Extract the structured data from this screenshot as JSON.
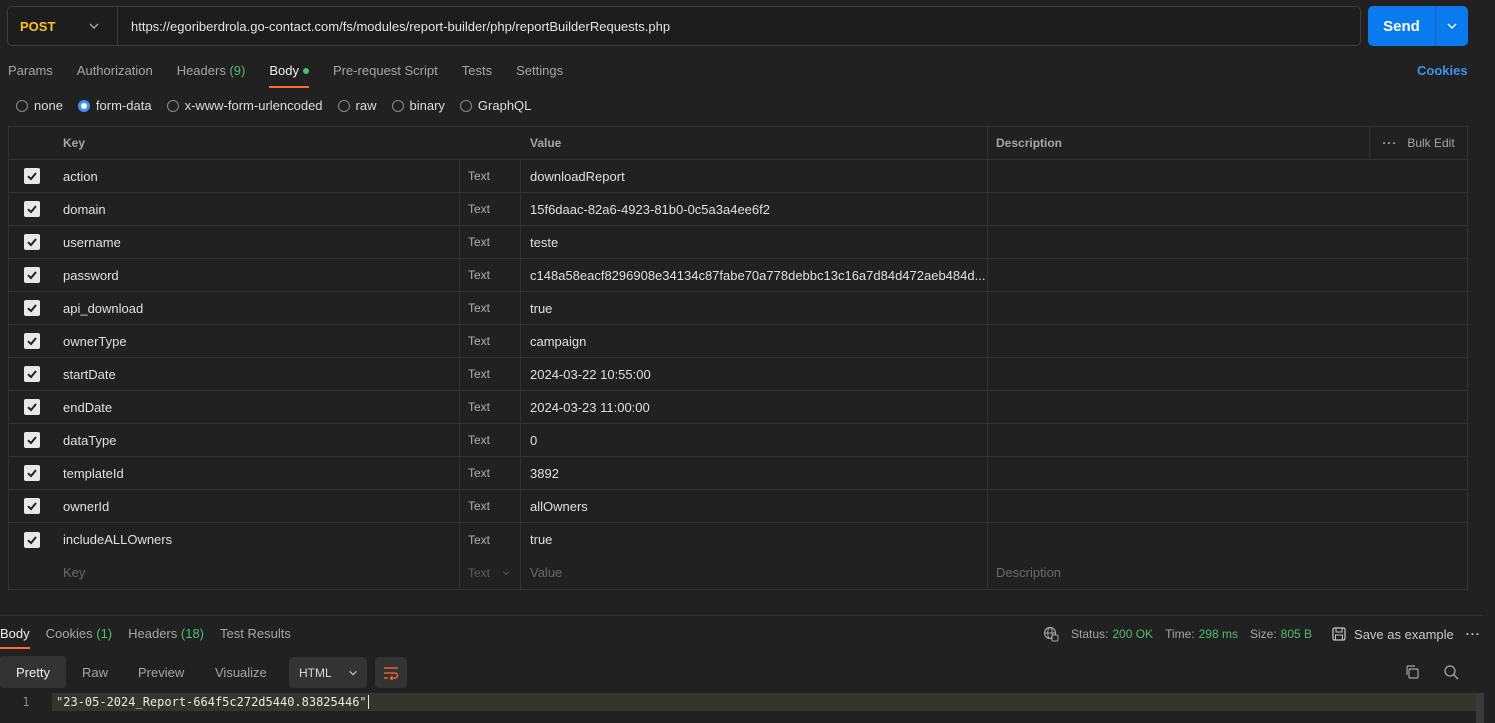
{
  "request": {
    "method": "POST",
    "url": "https://egoriberdrola.go-contact.com/fs/modules/report-builder/php/reportBuilderRequests.php",
    "send_label": "Send"
  },
  "request_tabs": [
    {
      "label": "Params"
    },
    {
      "label": "Authorization"
    },
    {
      "label": "Headers",
      "count": "(9)"
    },
    {
      "label": "Body",
      "active": true
    },
    {
      "label": "Pre-request Script"
    },
    {
      "label": "Tests"
    },
    {
      "label": "Settings"
    }
  ],
  "cookies_label": "Cookies",
  "body_types": [
    "none",
    "form-data",
    "x-www-form-urlencoded",
    "raw",
    "binary",
    "GraphQL"
  ],
  "body_type_selected": "form-data",
  "table": {
    "headers": {
      "key": "Key",
      "value": "Value",
      "description": "Description",
      "bulk_edit": "Bulk Edit"
    },
    "rows": [
      {
        "key": "action",
        "type": "Text",
        "value": "downloadReport"
      },
      {
        "key": "domain",
        "type": "Text",
        "value": "15f6daac-82a6-4923-81b0-0c5a3a4ee6f2"
      },
      {
        "key": "username",
        "type": "Text",
        "value": "teste"
      },
      {
        "key": "password",
        "type": "Text",
        "value": "c148a58eacf8296908e34134c87fabe70a778debbc13c16a7d84d472aeb484d..."
      },
      {
        "key": "api_download",
        "type": "Text",
        "value": "true"
      },
      {
        "key": "ownerType",
        "type": "Text",
        "value": "campaign"
      },
      {
        "key": "startDate",
        "type": "Text",
        "value": "2024-03-22 10:55:00"
      },
      {
        "key": "endDate",
        "type": "Text",
        "value": "2024-03-23 11:00:00"
      },
      {
        "key": "dataType",
        "type": "Text",
        "value": "0"
      },
      {
        "key": "templateId",
        "type": "Text",
        "value": "3892"
      },
      {
        "key": "ownerId",
        "type": "Text",
        "value": "allOwners"
      },
      {
        "key": "includeALLOwners",
        "type": "Text",
        "value": "true"
      }
    ],
    "placeholder": {
      "key": "Key",
      "type": "Text",
      "value": "Value",
      "description": "Description"
    }
  },
  "response": {
    "tabs": [
      {
        "label": "Body",
        "active": true
      },
      {
        "label": "Cookies",
        "count": "(1)"
      },
      {
        "label": "Headers",
        "count": "(18)"
      },
      {
        "label": "Test Results"
      }
    ],
    "status_label": "Status:",
    "status_value": "200 OK",
    "time_label": "Time:",
    "time_value": "298 ms",
    "size_label": "Size:",
    "size_value": "805 B",
    "save_example": "Save as example",
    "view_modes": [
      "Pretty",
      "Raw",
      "Preview",
      "Visualize"
    ],
    "view_selected": "Pretty",
    "format": "HTML",
    "lines": [
      {
        "number": "1",
        "text": "\"23-05-2024_Report-664f5c272d5440.83825446\""
      }
    ]
  },
  "colors": {
    "accent": "#ff6c37",
    "send": "#097bed",
    "method": "#ffc226",
    "success": "#4fbe6f"
  }
}
